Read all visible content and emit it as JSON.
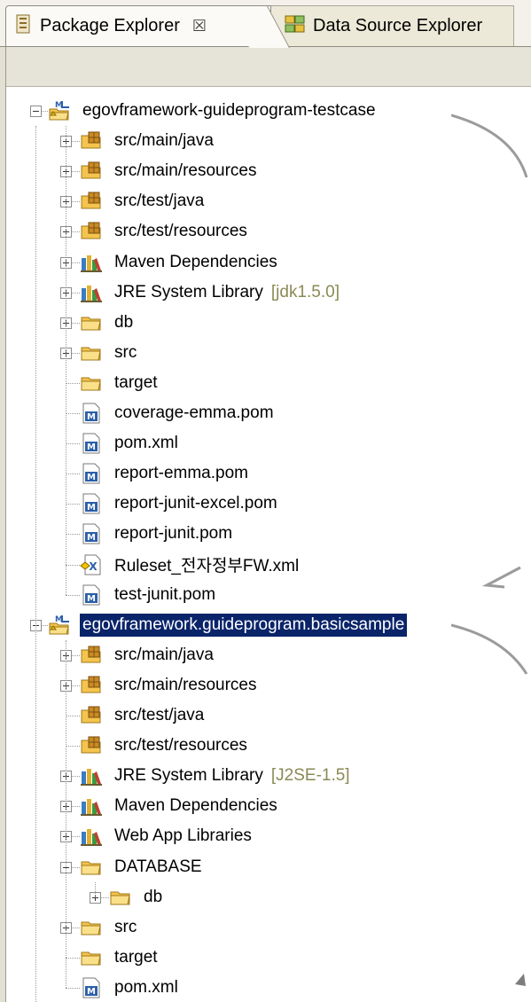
{
  "tabs": [
    {
      "label": "Package Explorer",
      "close": "☒",
      "active": true
    },
    {
      "label": "Data Source Explorer",
      "active": false
    }
  ],
  "tree": [
    {
      "label": "egovframework-guideprogram-testcase",
      "icon": "maven-project-icon",
      "level": 0,
      "state": "expanded",
      "name": "project-testcase"
    },
    {
      "label": "src/main/java",
      "icon": "source-folder-icon",
      "level": 1,
      "state": "collapsed"
    },
    {
      "label": "src/main/resources",
      "icon": "source-folder-icon",
      "level": 1,
      "state": "collapsed"
    },
    {
      "label": "src/test/java",
      "icon": "source-folder-icon",
      "level": 1,
      "state": "collapsed"
    },
    {
      "label": "src/test/resources",
      "icon": "source-folder-icon",
      "level": 1,
      "state": "collapsed"
    },
    {
      "label": "Maven Dependencies",
      "icon": "library-icon",
      "level": 1,
      "state": "collapsed"
    },
    {
      "label": "JRE System Library",
      "decoration": "[jdk1.5.0]",
      "icon": "library-icon",
      "level": 1,
      "state": "collapsed"
    },
    {
      "label": "db",
      "icon": "folder-icon",
      "level": 1,
      "state": "collapsed"
    },
    {
      "label": "src",
      "icon": "folder-icon",
      "level": 1,
      "state": "collapsed"
    },
    {
      "label": "target",
      "icon": "folder-icon",
      "level": 1,
      "state": "leaf"
    },
    {
      "label": "coverage-emma.pom",
      "icon": "pom-file-icon",
      "level": 1,
      "state": "leaf"
    },
    {
      "label": "pom.xml",
      "icon": "pom-file-icon",
      "level": 1,
      "state": "leaf"
    },
    {
      "label": "report-emma.pom",
      "icon": "pom-file-icon",
      "level": 1,
      "state": "leaf"
    },
    {
      "label": "report-junit-excel.pom",
      "icon": "pom-file-icon",
      "level": 1,
      "state": "leaf"
    },
    {
      "label": "report-junit.pom",
      "icon": "pom-file-icon",
      "level": 1,
      "state": "leaf"
    },
    {
      "label": "Ruleset_전자정부FW.xml",
      "icon": "xml-file-icon",
      "level": 1,
      "state": "leaf"
    },
    {
      "label": "test-junit.pom",
      "icon": "pom-file-icon",
      "level": 1,
      "state": "leaf"
    },
    {
      "label": "egovframework.guideprogram.basicsample",
      "icon": "maven-project-icon",
      "level": 0,
      "state": "expanded",
      "selected": true,
      "name": "project-basicsample"
    },
    {
      "label": "src/main/java",
      "icon": "source-folder-icon",
      "level": 1,
      "state": "collapsed"
    },
    {
      "label": "src/main/resources",
      "icon": "source-folder-icon",
      "level": 1,
      "state": "collapsed"
    },
    {
      "label": "src/test/java",
      "icon": "source-folder-icon",
      "level": 1,
      "state": "leaf"
    },
    {
      "label": "src/test/resources",
      "icon": "source-folder-icon",
      "level": 1,
      "state": "leaf"
    },
    {
      "label": "JRE System Library",
      "decoration": "[J2SE-1.5]",
      "icon": "library-icon",
      "level": 1,
      "state": "collapsed"
    },
    {
      "label": "Maven Dependencies",
      "icon": "library-icon",
      "level": 1,
      "state": "collapsed"
    },
    {
      "label": "Web App Libraries",
      "icon": "library-icon",
      "level": 1,
      "state": "collapsed"
    },
    {
      "label": "DATABASE",
      "icon": "folder-icon",
      "level": 1,
      "state": "expanded"
    },
    {
      "label": "db",
      "icon": "folder-icon",
      "level": 2,
      "state": "collapsed"
    },
    {
      "label": "src",
      "icon": "folder-icon",
      "level": 1,
      "state": "collapsed"
    },
    {
      "label": "target",
      "icon": "folder-icon",
      "level": 1,
      "state": "leaf"
    },
    {
      "label": "pom.xml",
      "icon": "pom-file-icon",
      "level": 1,
      "state": "leaf"
    }
  ],
  "colors": {
    "selection": "#0a246a",
    "decoration": "#8a8a55",
    "folder": "#f4c44e",
    "package": "#c98a24"
  }
}
